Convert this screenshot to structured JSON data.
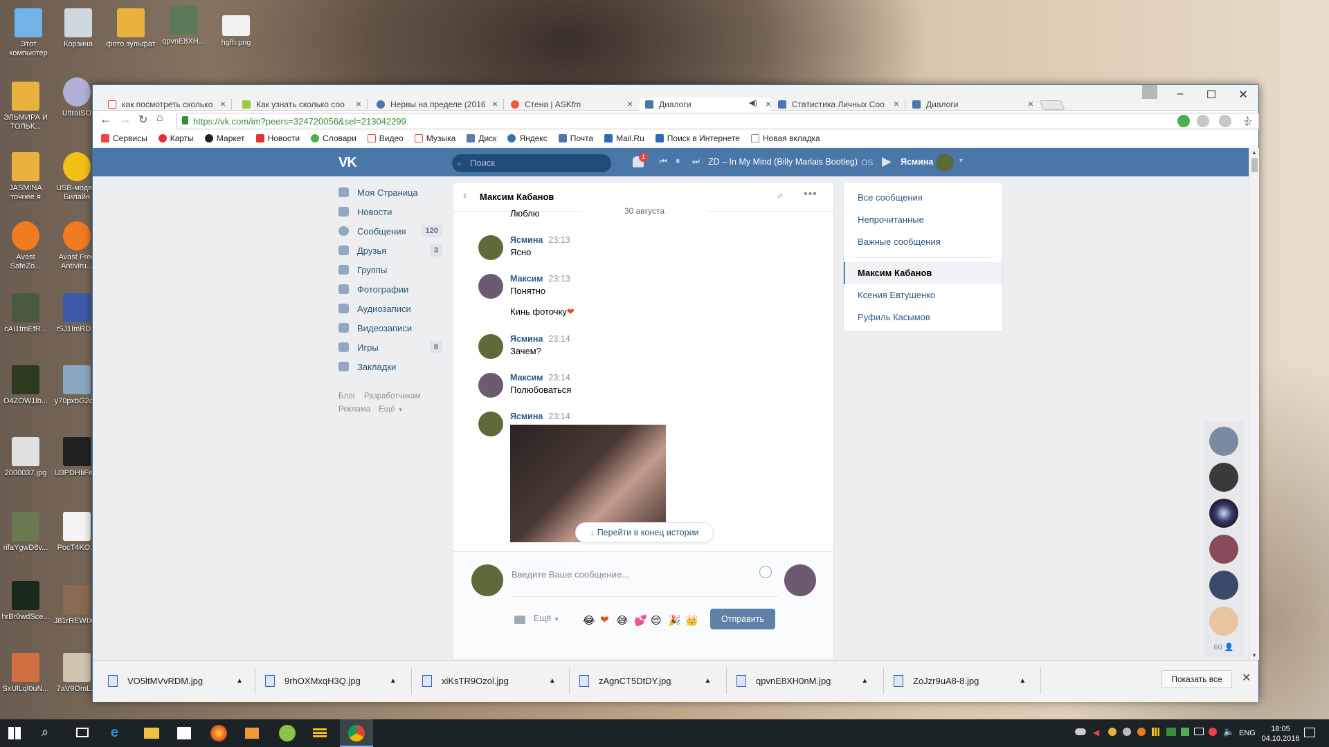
{
  "desktop": {
    "icons": [
      {
        "label": "Этот компьютер",
        "color": "#6fb3e8"
      },
      {
        "label": "Корзина",
        "color": "#cfd8dc"
      },
      {
        "label": "фото зульфат",
        "color": "#e8b23c"
      },
      {
        "label": "qpvnE8XH...",
        "color": "#5a7a5a"
      },
      {
        "label": "hgfh.png",
        "color": "#f2f2f2"
      },
      {
        "label": "ЭЛЬМИРА И ТОЛЬК...",
        "color": "#e8b23c"
      },
      {
        "label": "UltraISO",
        "color": "#b0b0d8"
      },
      {
        "label": "JASMINA точнее я",
        "color": "#e8b23c"
      },
      {
        "label": "USB-модем Билайн",
        "color": "#f3c017"
      },
      {
        "label": "Avast SafeZo...",
        "color": "#f07b20"
      },
      {
        "label": "Avast Free Antiviru...",
        "color": "#f07b20"
      },
      {
        "label": "cAI1tmEfR...",
        "color": "#4a5a40"
      },
      {
        "label": "r5J1ImRD...",
        "color": "#3c5aa8"
      },
      {
        "label": "O4ZOW1lb...",
        "color": "#2e3a20"
      },
      {
        "label": "y70pxbG2c...",
        "color": "#8aa8c0"
      },
      {
        "label": "2000037.jpg",
        "color": "#e0e0e0"
      },
      {
        "label": "U3PDHIiFe...",
        "color": "#222222"
      },
      {
        "label": "rifaYgwD8v...",
        "color": "#6a7a50"
      },
      {
        "label": "PocT4KO...",
        "color": "#f4f4f4"
      },
      {
        "label": "hrBr0wdSce...",
        "color": "#1a2a1a"
      },
      {
        "label": "J81rREWIX...",
        "color": "#8a6a50"
      },
      {
        "label": "SxUlLql0uN...",
        "color": "#d07040"
      },
      {
        "label": "7aV9OmL...",
        "color": "#cfc4b0"
      }
    ]
  },
  "browser": {
    "tabs": [
      {
        "title": "как посмотреть сколько",
        "color": "#e04040"
      },
      {
        "title": "Как узнать сколько соо",
        "color": "#9ccc3c"
      },
      {
        "title": "Нервы на пределе (2016",
        "color": "#4a76a8"
      },
      {
        "title": "Стена | ASKfm",
        "color": "#ee5a4a"
      },
      {
        "title": "Диалоги",
        "color": "#4a76a8"
      },
      {
        "title": "Статистика Личных Соо",
        "color": "#4a76a8"
      },
      {
        "title": "Диалоги",
        "color": "#4a76a8"
      }
    ],
    "url": "https://vk.com/im?peers=324720056&sel=213042299",
    "bookmarks": [
      {
        "label": "Сервисы",
        "color": "#e44"
      },
      {
        "label": "Карты",
        "color": "#e03030"
      },
      {
        "label": "Маркет",
        "color": "#222"
      },
      {
        "label": "Новости",
        "color": "#d33"
      },
      {
        "label": "Словари",
        "color": "#4caf50"
      },
      {
        "label": "Видео",
        "color": "#e44"
      },
      {
        "label": "Музыка",
        "color": "#e44"
      },
      {
        "label": "Диск",
        "color": "#5a7ea8"
      },
      {
        "label": "Яндекс",
        "color": "#3a6ea5"
      },
      {
        "label": "Почта",
        "color": "#4a76a8"
      },
      {
        "label": "Mail.Ru",
        "color": "#2a6ab8"
      },
      {
        "label": "Поиск в Интернете",
        "color": "#2a6ab8"
      },
      {
        "label": "Новая вкладка",
        "color": "#888"
      }
    ]
  },
  "vk": {
    "search_placeholder": "Поиск",
    "notif_count": "1",
    "track": "ZD – In My Mind (Billy Marlais Bootleg)",
    "os_label": "OS",
    "user_name": "Ясмина",
    "menu": [
      {
        "label": "Моя Страница",
        "count": ""
      },
      {
        "label": "Новости",
        "count": ""
      },
      {
        "label": "Сообщения",
        "count": "120"
      },
      {
        "label": "Друзья",
        "count": "3"
      },
      {
        "label": "Группы",
        "count": ""
      },
      {
        "label": "Фотографии",
        "count": ""
      },
      {
        "label": "Аудиозаписи",
        "count": ""
      },
      {
        "label": "Видеозаписи",
        "count": ""
      },
      {
        "label": "Игры",
        "count": "8"
      },
      {
        "label": "Закладки",
        "count": ""
      }
    ],
    "footer_links": [
      "Блог",
      "Разработчикам",
      "Реклама",
      "Ещё"
    ],
    "chat": {
      "title": "Максим Кабанов",
      "date": "30 августа",
      "prev_text": "Люблю",
      "messages": [
        {
          "name": "Ясмина",
          "time": "23:13",
          "text": "Ясно",
          "extra": ""
        },
        {
          "name": "Максим",
          "time": "23:13",
          "text": "Понятно",
          "extra": "Кинь фоточку"
        },
        {
          "name": "Ясмина",
          "time": "23:14",
          "text": "Зачем?",
          "extra": ""
        },
        {
          "name": "Максим",
          "time": "23:14",
          "text": "Полюбоваться",
          "extra": ""
        },
        {
          "name": "Ясмина",
          "time": "23:14",
          "text": "",
          "extra": ""
        }
      ],
      "jump_label": "Перейти в конец истории",
      "input_placeholder": "Введите Ваше сообщение...",
      "more_label": "Ещё",
      "send_label": "Отправить"
    },
    "right_menu": [
      "Все сообщения",
      "Непрочитанные",
      "Важные сообщения"
    ],
    "dialogs": [
      "Максим Кабанов",
      "Ксения Евтушенко",
      "Руфиль Касымов"
    ],
    "friends_count": "60"
  },
  "downloads": {
    "files": [
      "VO5ltMVvRDM.jpg",
      "9rhOXMxqH3Q.jpg",
      "xiKsTR9Ozol.jpg",
      "zAgnCT5DtDY.jpg",
      "qpvnE8XH0nM.jpg",
      "ZoJzr9uA8-8.jpg"
    ],
    "show_all": "Показать все"
  },
  "taskbar": {
    "lang": "ENG",
    "time": "18:05",
    "date": "04.10.2016"
  }
}
